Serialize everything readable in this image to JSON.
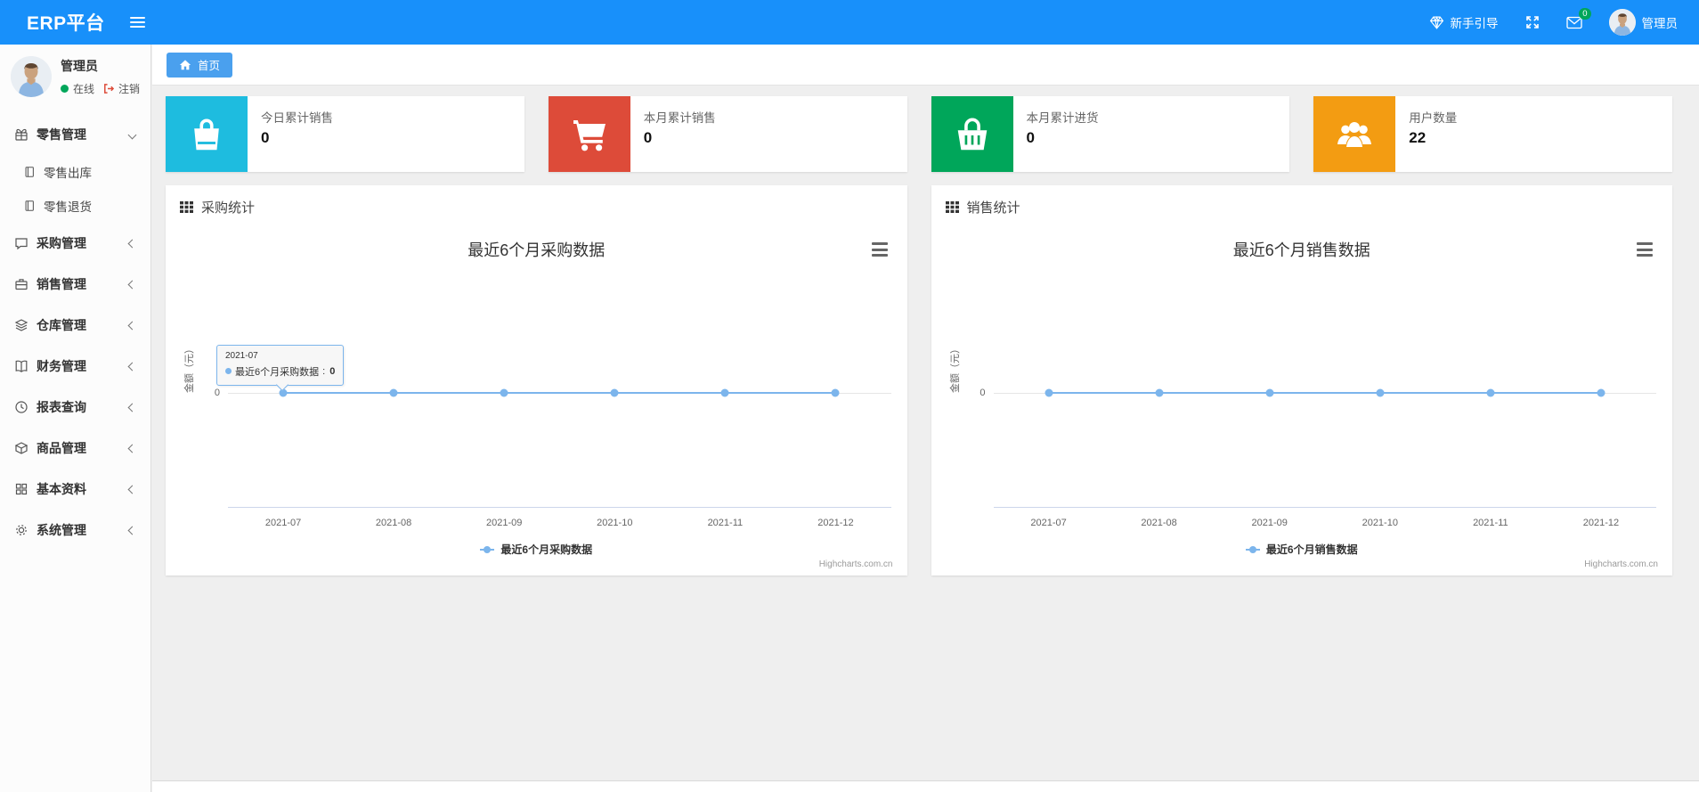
{
  "theme": {
    "navbar_bg": "#1890fa",
    "tab_bg": "#4aa0ee",
    "badge_green": "#00a65a",
    "chart_line": "#7cb5ec"
  },
  "navbar": {
    "brand": "ERP平台",
    "guide_label": "新手引导",
    "badge_count": "0",
    "user_name": "管理员"
  },
  "sidebar": {
    "user": {
      "name": "管理员",
      "status": "在线",
      "logout": "注销"
    },
    "menu": [
      {
        "label": "零售管理",
        "icon": "gift-icon",
        "expanded": true,
        "children": [
          {
            "label": "零售出库",
            "icon": "journal-icon"
          },
          {
            "label": "零售退货",
            "icon": "journal-icon"
          }
        ]
      },
      {
        "label": "采购管理",
        "icon": "chat-icon"
      },
      {
        "label": "销售管理",
        "icon": "briefcase-icon"
      },
      {
        "label": "仓库管理",
        "icon": "layers-icon"
      },
      {
        "label": "财务管理",
        "icon": "book-icon"
      },
      {
        "label": "报表查询",
        "icon": "clock-icon"
      },
      {
        "label": "商品管理",
        "icon": "package-icon"
      },
      {
        "label": "基本资料",
        "icon": "grid-icon"
      },
      {
        "label": "系统管理",
        "icon": "gear-icon"
      }
    ]
  },
  "tabs": {
    "home": "首页"
  },
  "cards": [
    {
      "label": "今日累计销售",
      "value": "0",
      "color": "#1ebcdf",
      "icon": "shopping-bag-icon"
    },
    {
      "label": "本月累计销售",
      "value": "0",
      "color": "#dd4b39",
      "icon": "cart-icon"
    },
    {
      "label": "本月累计进货",
      "value": "0",
      "color": "#00a65a",
      "icon": "basket-icon"
    },
    {
      "label": "用户数量",
      "value": "22",
      "color": "#f39c12",
      "icon": "users-icon"
    }
  ],
  "panels": [
    {
      "header": "采购统计"
    },
    {
      "header": "销售统计"
    }
  ],
  "chart_data": [
    {
      "type": "line",
      "title": "最近6个月采购数据",
      "categories": [
        "2021-07",
        "2021-08",
        "2021-09",
        "2021-10",
        "2021-11",
        "2021-12"
      ],
      "series": [
        {
          "name": "最近6个月采购数据",
          "values": [
            0,
            0,
            0,
            0,
            0,
            0
          ]
        }
      ],
      "xlabel": "",
      "ylabel": "金额（元）",
      "yticks": [
        "0"
      ],
      "ylim": [
        0,
        0
      ],
      "grid": true,
      "legend_position": "bottom",
      "line_color": "#7cb5ec",
      "credits": "Highcharts.com.cn",
      "tooltip": {
        "header": "2021-07",
        "series": "最近6个月采购数据",
        "separator": ":",
        "value": "0"
      }
    },
    {
      "type": "line",
      "title": "最近6个月销售数据",
      "categories": [
        "2021-07",
        "2021-08",
        "2021-09",
        "2021-10",
        "2021-11",
        "2021-12"
      ],
      "series": [
        {
          "name": "最近6个月销售数据",
          "values": [
            0,
            0,
            0,
            0,
            0,
            0
          ]
        }
      ],
      "xlabel": "",
      "ylabel": "金额（元）",
      "yticks": [
        "0"
      ],
      "ylim": [
        0,
        0
      ],
      "grid": true,
      "legend_position": "bottom",
      "line_color": "#7cb5ec",
      "credits": "Highcharts.com.cn"
    }
  ]
}
